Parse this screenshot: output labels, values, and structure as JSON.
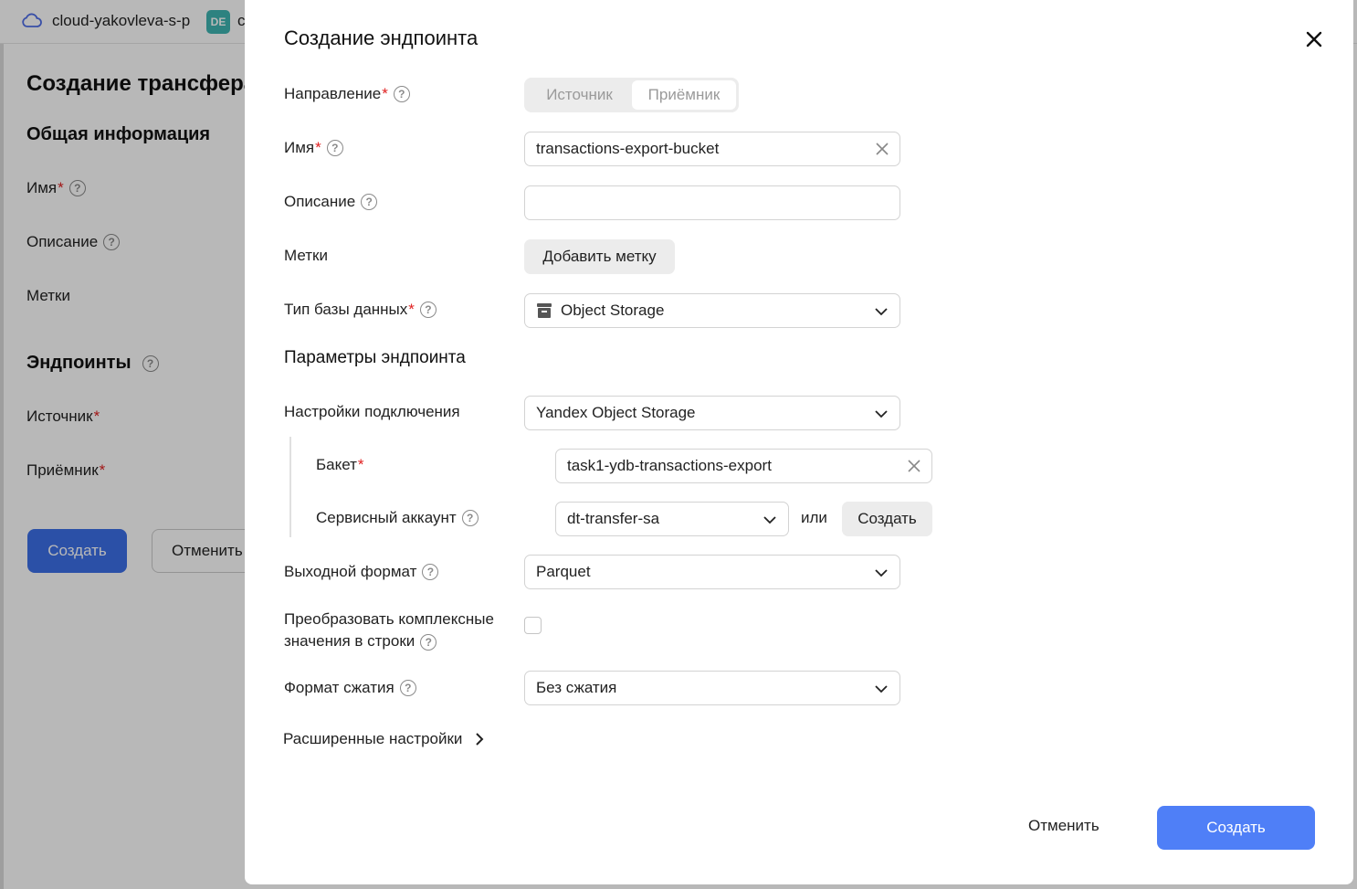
{
  "background": {
    "cloud_name": "cloud-yakovleva-s-p",
    "badge": "DE",
    "badge_after": "c",
    "title": "Создание трансфера",
    "section_general": "Общая информация",
    "name_label": "Имя",
    "description_label": "Описание",
    "labels_label": "Метки",
    "endpoints_label": "Эндпоинты",
    "source_label": "Источник",
    "target_label": "Приёмник",
    "create_button": "Создать",
    "cancel_button": "Отменить"
  },
  "modal": {
    "title": "Создание эндпоинта",
    "direction": {
      "label": "Направление",
      "options": [
        "Источник",
        "Приёмник"
      ],
      "selected": "Приёмник"
    },
    "name": {
      "label": "Имя",
      "value": "transactions-export-bucket"
    },
    "description": {
      "label": "Описание",
      "value": ""
    },
    "labels": {
      "label": "Метки",
      "add_button": "Добавить метку"
    },
    "db_type": {
      "label": "Тип базы данных",
      "value": "Object Storage",
      "icon": "storage-icon"
    },
    "params_title": "Параметры эндпоинта",
    "connection": {
      "label": "Настройки подключения",
      "value": "Yandex Object Storage"
    },
    "bucket": {
      "label": "Бакет",
      "value": "task1-ydb-transactions-export"
    },
    "service_account": {
      "label": "Сервисный аккаунт",
      "value": "dt-transfer-sa",
      "or_text": "или",
      "create_button": "Создать"
    },
    "output_format": {
      "label": "Выходной формат",
      "value": "Parquet"
    },
    "convert_complex": {
      "label": "Преобразовать комплексные значения в строки",
      "checked": false
    },
    "compression": {
      "label": "Формат сжатия",
      "value": "Без сжатия"
    },
    "advanced": "Расширенные настройки",
    "cancel_button": "Отменить",
    "create_button": "Создать"
  }
}
